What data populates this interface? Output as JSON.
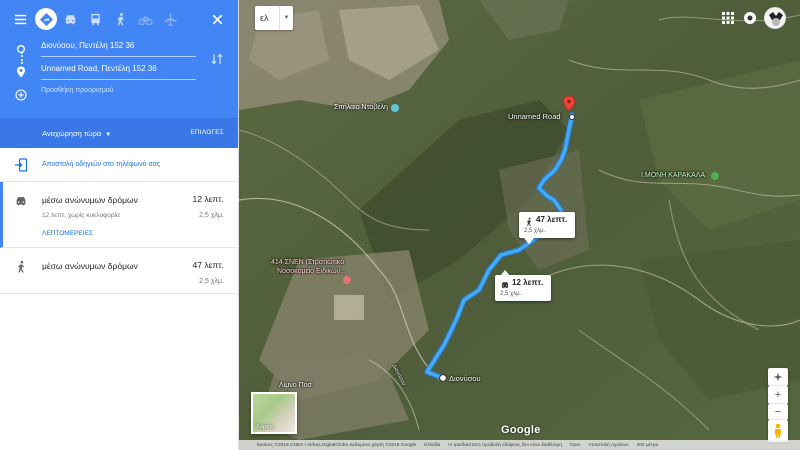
{
  "header": {
    "origin": "Διονύσου, Πεντέλη 152 36",
    "destination": "Unnamed Road, Πεντέλη 152 36",
    "add_destination": "Προσθήκη προορισμού"
  },
  "depart": {
    "label": "Αναχώρηση τώρα",
    "options_label": "ΕΠΙΛΟΓΕΣ"
  },
  "send_to_phone": "Αποστολή οδηγιών στο τηλέφωνό σας",
  "routes": [
    {
      "title": "μέσω ανώνυμων δρόμων",
      "time": "12 λεπτ.",
      "subtitle": "12 λεπτ. χωρίς κυκλοφορία",
      "distance": "2,5 χλμ.",
      "details": "ΛΕΠΤΟΜΕΡΕΙΕΣ",
      "mode": "car"
    },
    {
      "title": "μέσω ανώνυμων δρόμων",
      "time": "47 λεπτ.",
      "distance": "2,5 χλμ.",
      "mode": "walk"
    }
  ],
  "map": {
    "language": "ελ",
    "labels": {
      "cave": "Σπήλαιο Νταβέλη",
      "destination": "Unnamed Road",
      "church": "Ι.ΜΟΝΗ ΚΑΡΑΚΑΛΑ",
      "hospital_line1": "414 ΣΝΕΝ (Στρατιωτικό",
      "hospital_line2": "Νοσοκομείο Ειδικών...",
      "origin": "Διονύσου",
      "lake": "Λιμνο Ποσ",
      "road_small": "Διονύσου"
    },
    "callouts": {
      "walk": {
        "time": "47 λεπτ.",
        "distance": "2,5 χλμ."
      },
      "car": {
        "time": "12 λεπτ.",
        "distance": "2,5 χλμ."
      }
    },
    "thumbnail_label": "Χάρτης",
    "google": "Google",
    "footer": [
      "Εικόνες ©2018 CNES / Airbus,DigitalGlobe,Δεδομένα χάρτη ©2018 Google",
      "Ελλάδα",
      "Η τρισδιάστατη προβολή εδάφους δεν είναι διαθέσιμη",
      "Όροι",
      "Αποστολή σχολίων",
      "200 μέτρα"
    ],
    "colors": {
      "route": "#4aa8f0",
      "panel_blue": "#4285f4",
      "pin": "#ea4335"
    }
  }
}
